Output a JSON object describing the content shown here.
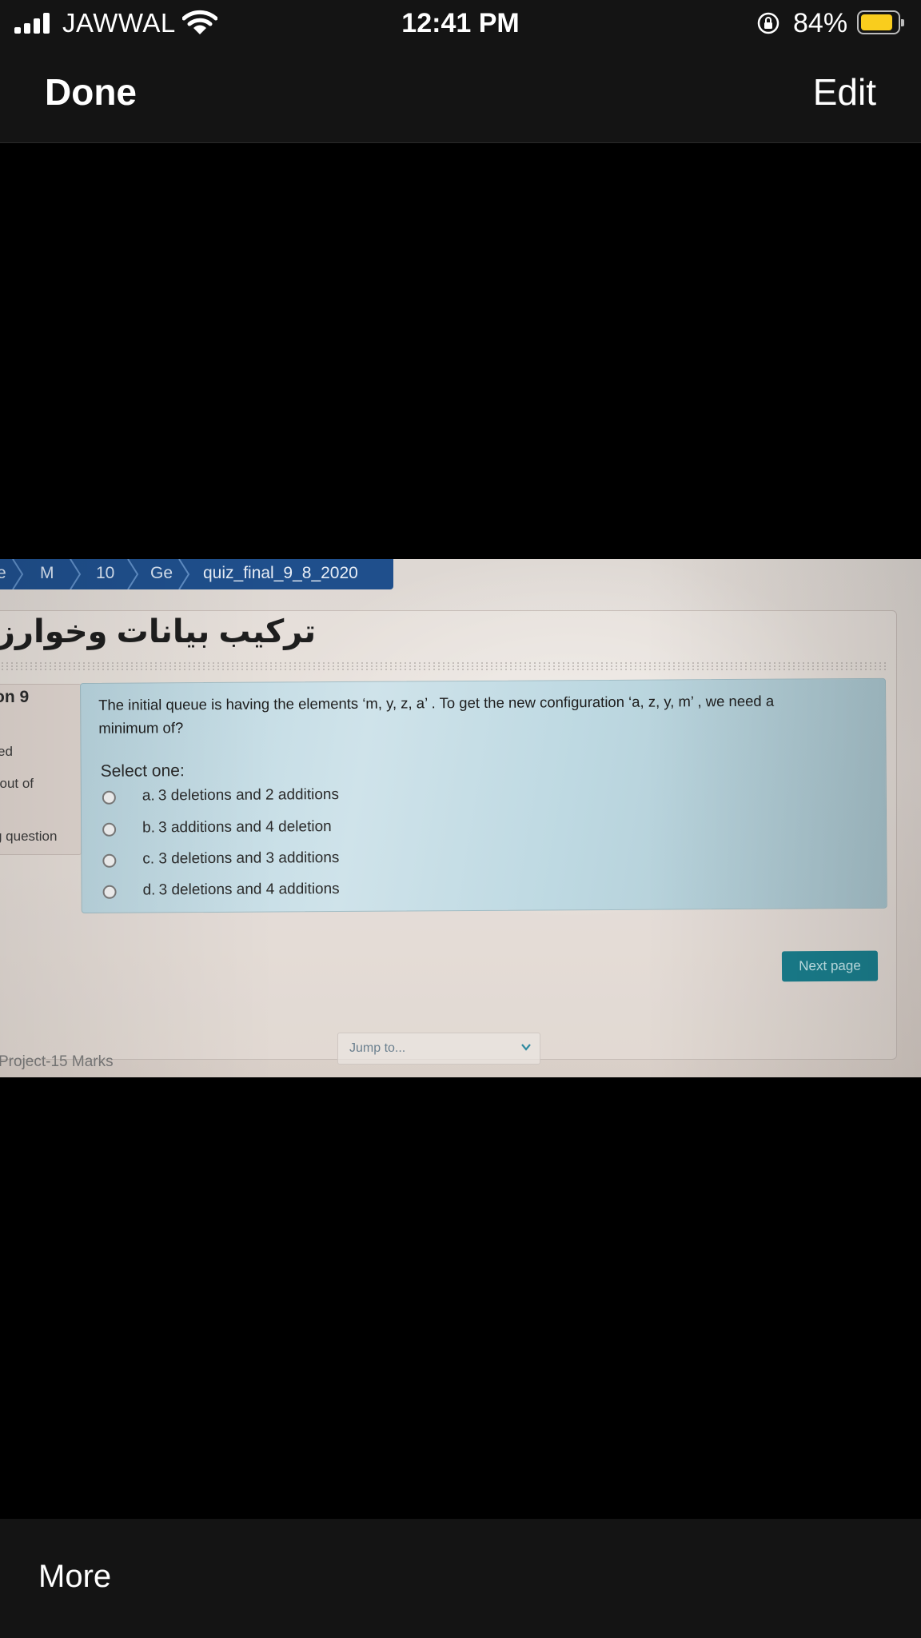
{
  "status_bar": {
    "carrier": "JAWWAL",
    "time": "12:41 PM",
    "battery_percent": "84%",
    "battery_level": 0.84,
    "battery_color": "#f9cd1d",
    "icons": [
      "signal-icon",
      "wifi-icon",
      "orientation-lock-icon",
      "battery-icon"
    ]
  },
  "nav": {
    "done_label": "Done",
    "edit_label": "Edit"
  },
  "photo": {
    "breadcrumb": [
      "e",
      "M",
      "10",
      "Ge",
      "quiz_final_9_8_2020"
    ],
    "breadcrumb_color": "#1f4f8c",
    "course_title": "تركيب بيانات وخوارز",
    "sidebar": {
      "question_label": "on 9",
      "line1": "ed",
      "line2": "l out of",
      "line3": "g question"
    },
    "question_text": "The initial  queue is having the elements ‘m, y, z, a’ . To get the new configuration ‘a, z, y, m’ , we need a minimum of?",
    "select_label": "Select one:",
    "options": [
      {
        "letter": "a.",
        "text": "3 deletions and 2 additions"
      },
      {
        "letter": "b.",
        "text": "3 additions and 4 deletion"
      },
      {
        "letter": "c.",
        "text": "3 deletions and 3 additions"
      },
      {
        "letter": "d.",
        "text": "3 deletions and 4 additions"
      }
    ],
    "next_page_label": "Next page",
    "jump_placeholder": "Jump to...",
    "footer_text": "Project-15 Marks"
  },
  "bottom_bar": {
    "more_label": "More"
  }
}
